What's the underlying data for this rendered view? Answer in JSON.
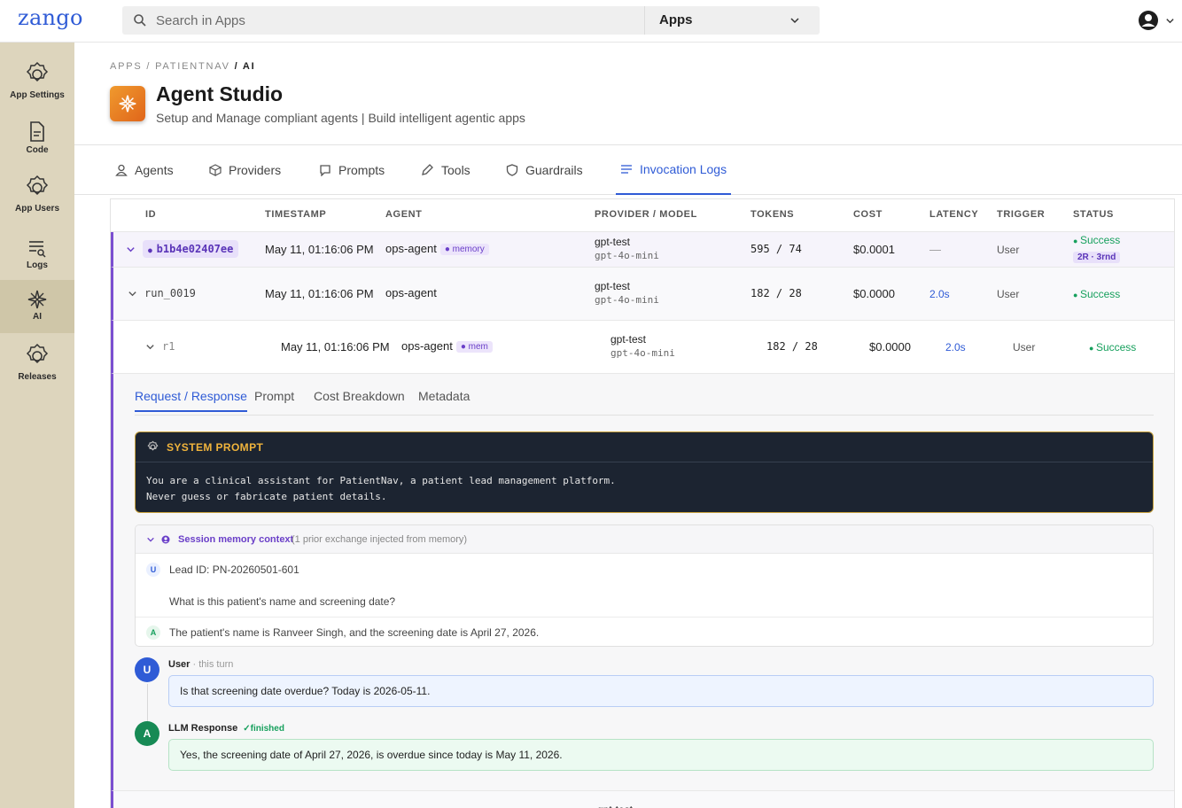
{
  "app": {
    "logo": "zango"
  },
  "search": {
    "placeholder": "Search in Apps",
    "scope": "Apps"
  },
  "sidebar": {
    "items": [
      {
        "label": "App Settings",
        "icon": "gear-icon"
      },
      {
        "label": "Code",
        "icon": "file-code-icon"
      },
      {
        "label": "App Users",
        "icon": "gear-icon"
      },
      {
        "label": "Logs",
        "icon": "logs-icon"
      },
      {
        "label": "AI",
        "icon": "sparkle-icon",
        "active": true
      },
      {
        "label": "Releases",
        "icon": "gear-icon"
      }
    ]
  },
  "header": {
    "breadcrumb": {
      "part1": "APPS / PATIENTNAV ",
      "current": "/ AI"
    },
    "title": "Agent Studio",
    "subtitle": "Setup and Manage compliant agents | Build intelligent agentic apps"
  },
  "tabs": [
    "Agents",
    "Providers",
    "Prompts",
    "Tools",
    "Guardrails",
    "Invocation Logs"
  ],
  "active_tab": "Invocation Logs",
  "table": {
    "columns": [
      "ID",
      "TIMESTAMP",
      "AGENT",
      "PROVIDER / MODEL",
      "TOKENS",
      "COST",
      "LATENCY",
      "TRIGGER",
      "STATUS"
    ],
    "rows": [
      {
        "id": "b1b4e02407ee",
        "timestamp": "May 11, 01:16:06 PM",
        "agent": "ops-agent",
        "agent_badge": "memory",
        "provider": "gpt-test",
        "model": "gpt-4o-mini",
        "tokens": "595 / 74",
        "cost": "$0.0001",
        "latency": "—",
        "trigger": "User",
        "status": "Success",
        "retry": "2R · 3rnd"
      },
      {
        "id": "run_0019",
        "timestamp": "May 11, 01:16:06 PM",
        "agent": "ops-agent",
        "provider": "gpt-test",
        "model": "gpt-4o-mini",
        "tokens": "182 / 28",
        "cost": "$0.0000",
        "latency": "2.0s",
        "trigger": "User",
        "status": "Success"
      },
      {
        "id": "r1",
        "timestamp": "May 11, 01:16:06 PM",
        "agent": "ops-agent",
        "agent_badge": "mem",
        "provider": "gpt-test",
        "model": "gpt-4o-mini",
        "tokens": "182 / 28",
        "cost": "$0.0000",
        "latency": "2.0s",
        "trigger": "User",
        "status": "Success"
      }
    ],
    "partial_row_provider": "gpt-test"
  },
  "detail": {
    "tabs": [
      "Request / Response",
      "Prompt",
      "Cost Breakdown",
      "Metadata"
    ],
    "system_prompt": {
      "title": "SYSTEM PROMPT",
      "text": "You are a clinical assistant for PatientNav, a patient lead management platform.\nNever guess or fabricate patient details."
    },
    "memory": {
      "title": "Session memory context",
      "note": "(1 prior exchange injected from memory)",
      "user_line1": "Lead ID: PN-20260501-601",
      "user_line2": "What is this patient's name and screening date?",
      "assistant": "The patient's name is Ranveer Singh, and the screening date is April 27, 2026."
    },
    "user_turn": {
      "role": "User",
      "sub": "· this turn",
      "text": "Is that screening date overdue? Today is 2026-05-11."
    },
    "llm_turn": {
      "role": "LLM Response",
      "status": "✓finished",
      "text": "Yes, the screening date of April 27, 2026, is overdue since today is May 11, 2026."
    },
    "chips": {
      "user": "U",
      "assistant": "A"
    }
  },
  "colors": {
    "accent": "#2f5bd6",
    "memory": "#6a3fc8",
    "success": "#17a05d",
    "sidebar": "#ddd5bd"
  }
}
